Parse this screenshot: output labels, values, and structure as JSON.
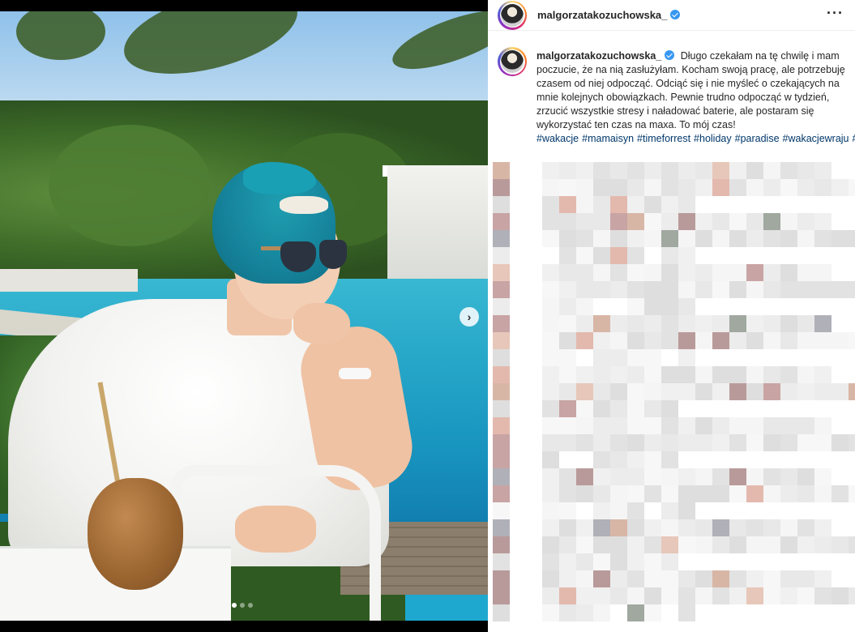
{
  "post": {
    "username": "malgorzatakozuchowska_",
    "verified": true,
    "more_icon": "more-horizontal-icon",
    "caption": {
      "username": "malgorzatakozuchowska_",
      "text": "Długo czekałam na tę chwilę i mam poczucie, że na nią zasłużyłam. Kocham swoją pracę, ale potrzebuję czasem od niej odpocząć. Odciąć się i nie myśleć o czekających na mnie kolejnych obowiązkach. Pewnie trudno odpocząć w tydzień, zrzucić wszystkie stresy i naładować baterie, ale postaram się wykorzystać ten czas na maxa. To mój czas!",
      "hashtags": [
        "#wakacje",
        "#mamaisyn",
        "#timeforrest",
        "#holiday",
        "#paradise",
        "#wakacjewraju",
        "#woman"
      ]
    }
  },
  "carousel": {
    "next_label": "›",
    "dot_count": 3,
    "active_dot": 0
  },
  "colors": {
    "hashtag": "#00376b",
    "verified": "#3897f0",
    "text": "#262626"
  }
}
